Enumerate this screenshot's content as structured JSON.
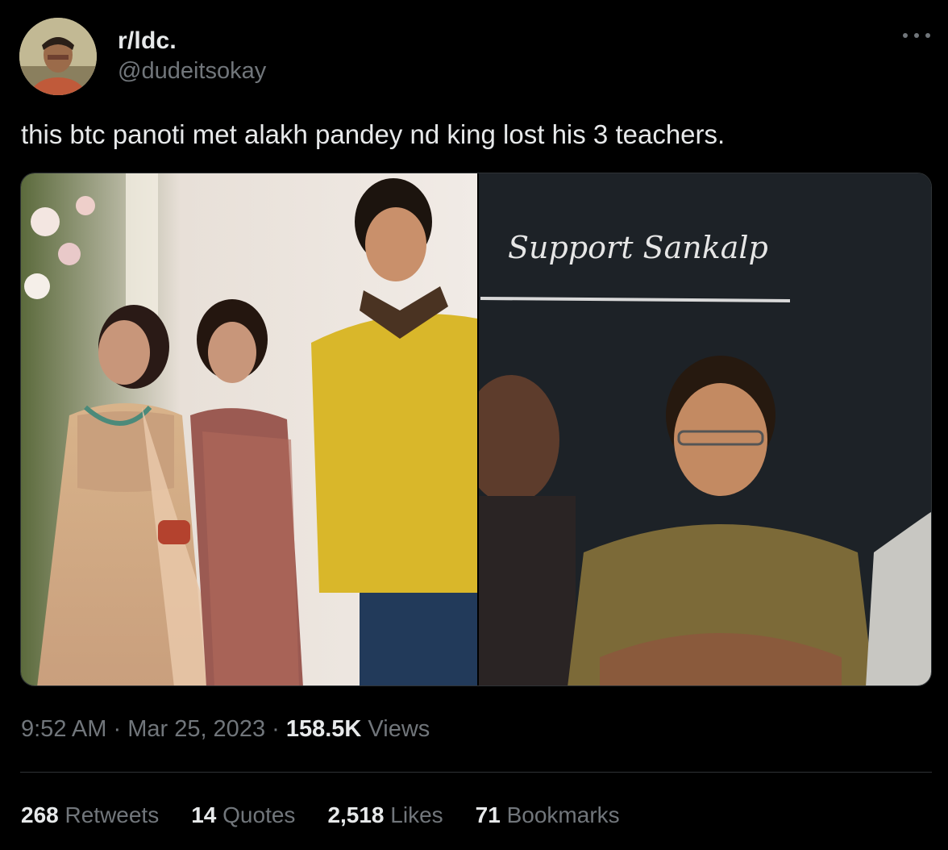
{
  "author": {
    "display_name": "r/ldc.",
    "handle": "@dudeitsokay"
  },
  "tweet": {
    "text": "this btc panoti met alakh pandey nd king lost his 3 teachers.",
    "media_right_board_text": "Support Sankalp"
  },
  "meta": {
    "time": "9:52 AM",
    "separator": " · ",
    "date": "Mar 25, 2023",
    "views_count": "158.5K",
    "views_label": " Views"
  },
  "stats": {
    "retweets": {
      "count": "268",
      "label": " Retweets"
    },
    "quotes": {
      "count": "14",
      "label": " Quotes"
    },
    "likes": {
      "count": "2,518",
      "label": " Likes"
    },
    "bookmarks": {
      "count": "71",
      "label": " Bookmarks"
    }
  },
  "icons": {
    "more": "more-horizontal-icon"
  },
  "colors": {
    "background": "#000000",
    "primary_text": "#e7e9ea",
    "secondary_text": "#71767b",
    "divider": "#2f3336"
  }
}
